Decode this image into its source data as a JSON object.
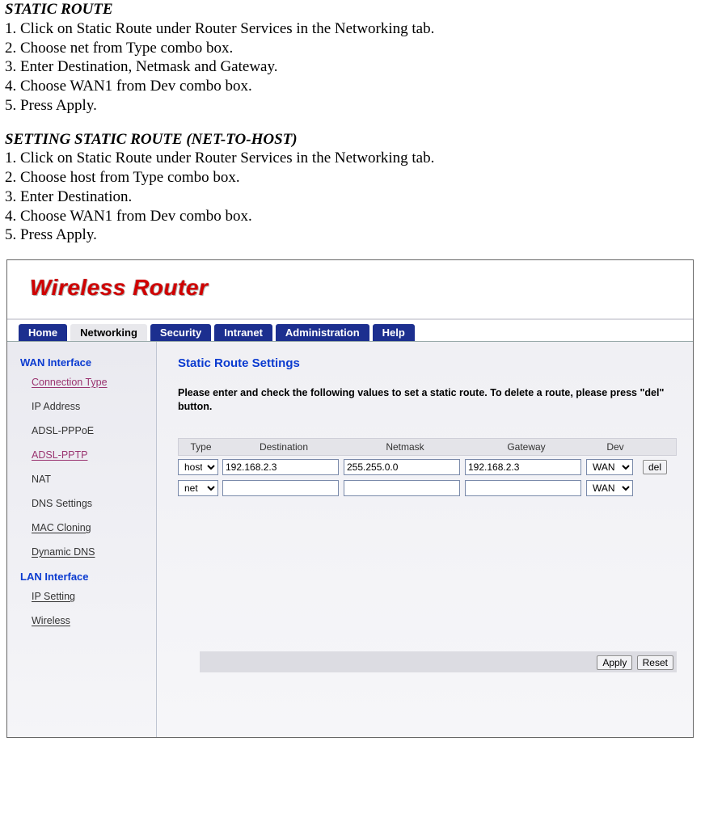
{
  "doc": {
    "heading1": "STATIC ROUTE",
    "section1": [
      "1. Click on Static Route under Router Services in the Networking tab.",
      "2. Choose net from Type combo box.",
      "3. Enter Destination, Netmask and Gateway.",
      "4. Choose WAN1 from Dev combo box.",
      "5. Press Apply."
    ],
    "heading2": "SETTING STATIC ROUTE (NET-TO-HOST)",
    "section2": [
      "1. Click on Static Route under Router Services in the Networking tab.",
      "2. Choose host from Type combo box.",
      "3. Enter Destination.",
      "4. Choose WAN1 from Dev combo box.",
      "5. Press Apply."
    ]
  },
  "app": {
    "brand": "Wireless Router",
    "tabs": [
      "Home",
      "Networking",
      "Security",
      "Intranet",
      "Administration",
      "Help"
    ],
    "active_tab_index": 1,
    "sidebar": {
      "section1": "WAN Interface",
      "items1": [
        "Connection Type",
        "IP Address",
        "ADSL-PPPoE",
        "ADSL-PPTP",
        "NAT",
        "DNS Settings",
        "MAC Cloning",
        "Dynamic DNS"
      ],
      "section2": "LAN Interface",
      "items2": [
        "IP Setting",
        "Wireless"
      ]
    },
    "content": {
      "title": "Static Route Settings",
      "description": "Please enter and check the following values to set a static route. To delete a route, please press \"del\" button.",
      "columns": {
        "type": "Type",
        "dest": "Destination",
        "mask": "Netmask",
        "gw": "Gateway",
        "dev": "Dev"
      },
      "rows": [
        {
          "type": "host",
          "dest": "192.168.2.3",
          "mask": "255.255.0.0",
          "gw": "192.168.2.3",
          "dev": "WAN",
          "del": "del"
        },
        {
          "type": "net",
          "dest": "",
          "mask": "",
          "gw": "",
          "dev": "WAN",
          "del": ""
        }
      ],
      "type_options": [
        "host",
        "net"
      ],
      "dev_options": [
        "WAN"
      ],
      "apply": "Apply",
      "reset": "Reset"
    }
  }
}
